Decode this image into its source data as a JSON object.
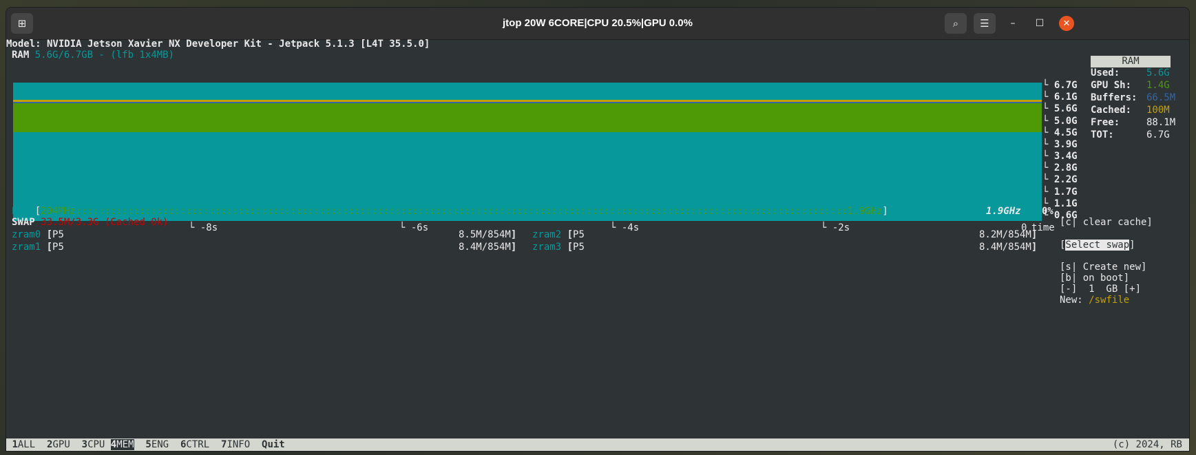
{
  "window": {
    "title": "jtop 20W 6CORE|CPU 20.5%|GPU 0.0%"
  },
  "model_line": "Model: NVIDIA Jetson Xavier NX Developer Kit - Jetpack 5.1.3 [L4T 35.5.0]",
  "ram": {
    "label": "RAM",
    "usage": "5.6G/6.7GB",
    "lfb": "- (lfb 1x4MB)"
  },
  "chart_data": {
    "type": "area",
    "title": "",
    "xlabel": "time",
    "ylabel": "",
    "x_ticks": [
      "-8s",
      "-6s",
      "-4s",
      "-2s",
      "0"
    ],
    "y_ticks": [
      "6.7G",
      "6.1G",
      "5.6G",
      "5.0G",
      "4.5G",
      "3.9G",
      "3.4G",
      "2.8G",
      "2.2G",
      "1.7G",
      "1.1G",
      "0.6G"
    ],
    "ylim": [
      0,
      6.7
    ],
    "series": [
      {
        "name": "Used",
        "value": 4.3,
        "color": "#06989a"
      },
      {
        "name": "GPU Sh",
        "value": 1.4,
        "color": "#4e9a06"
      },
      {
        "name": "Buffers",
        "value": 0.07,
        "color": "#3465a4"
      },
      {
        "name": "Cached",
        "value": 0.1,
        "color": "#c4a000"
      }
    ]
  },
  "ram_panel": {
    "title": "RAM",
    "rows": [
      {
        "label": "Used:",
        "value": "5.6G",
        "color": "#06989a"
      },
      {
        "label": "GPU Sh:",
        "value": "1.4G",
        "color": "#4e9a06"
      },
      {
        "label": "Buffers:",
        "value": "66.5M",
        "color": "#3465a4"
      },
      {
        "label": "Cached:",
        "value": "100M",
        "color": "#c4a000"
      },
      {
        "label": "Free:",
        "value": "88.1M",
        "color": "#e8e8e8"
      },
      {
        "label": "TOT:",
        "value": "6.7G",
        "color": "#e8e8e8"
      }
    ]
  },
  "emc": {
    "label": "Emc",
    "min": "204MHz",
    "max": "1.9GHz",
    "current": "1.9GHz",
    "percent": "0%"
  },
  "swap": {
    "label": "SWAP",
    "usage": "33.5M/3.3G (Cached 0k)",
    "items": [
      {
        "name": "zram0",
        "prio": "P5",
        "usage": "8.5M/854M"
      },
      {
        "name": "zram2",
        "prio": "P5",
        "usage": "8.2M/854M"
      },
      {
        "name": "zram1",
        "prio": "P5",
        "usage": "8.4M/854M"
      },
      {
        "name": "zram3",
        "prio": "P5",
        "usage": "8.4M/854M"
      }
    ]
  },
  "controls": {
    "clear_cache": "[c| clear cache]",
    "select_swap": "Select swap",
    "create_new": "[s| Create new]",
    "on_boot": "[b| on boot]",
    "size": "[-]  1  GB [+]",
    "new_label": "New:",
    "new_path": "/swfile"
  },
  "statusbar": {
    "tabs": [
      {
        "key": "1",
        "label": "ALL"
      },
      {
        "key": "2",
        "label": "GPU"
      },
      {
        "key": "3",
        "label": "CPU"
      },
      {
        "key": "4",
        "label": "MEM"
      },
      {
        "key": "5",
        "label": "ENG"
      },
      {
        "key": "6",
        "label": "CTRL"
      },
      {
        "key": "7",
        "label": "INFO"
      }
    ],
    "quit": "Quit",
    "copyright": "(c) 2024, RB"
  }
}
